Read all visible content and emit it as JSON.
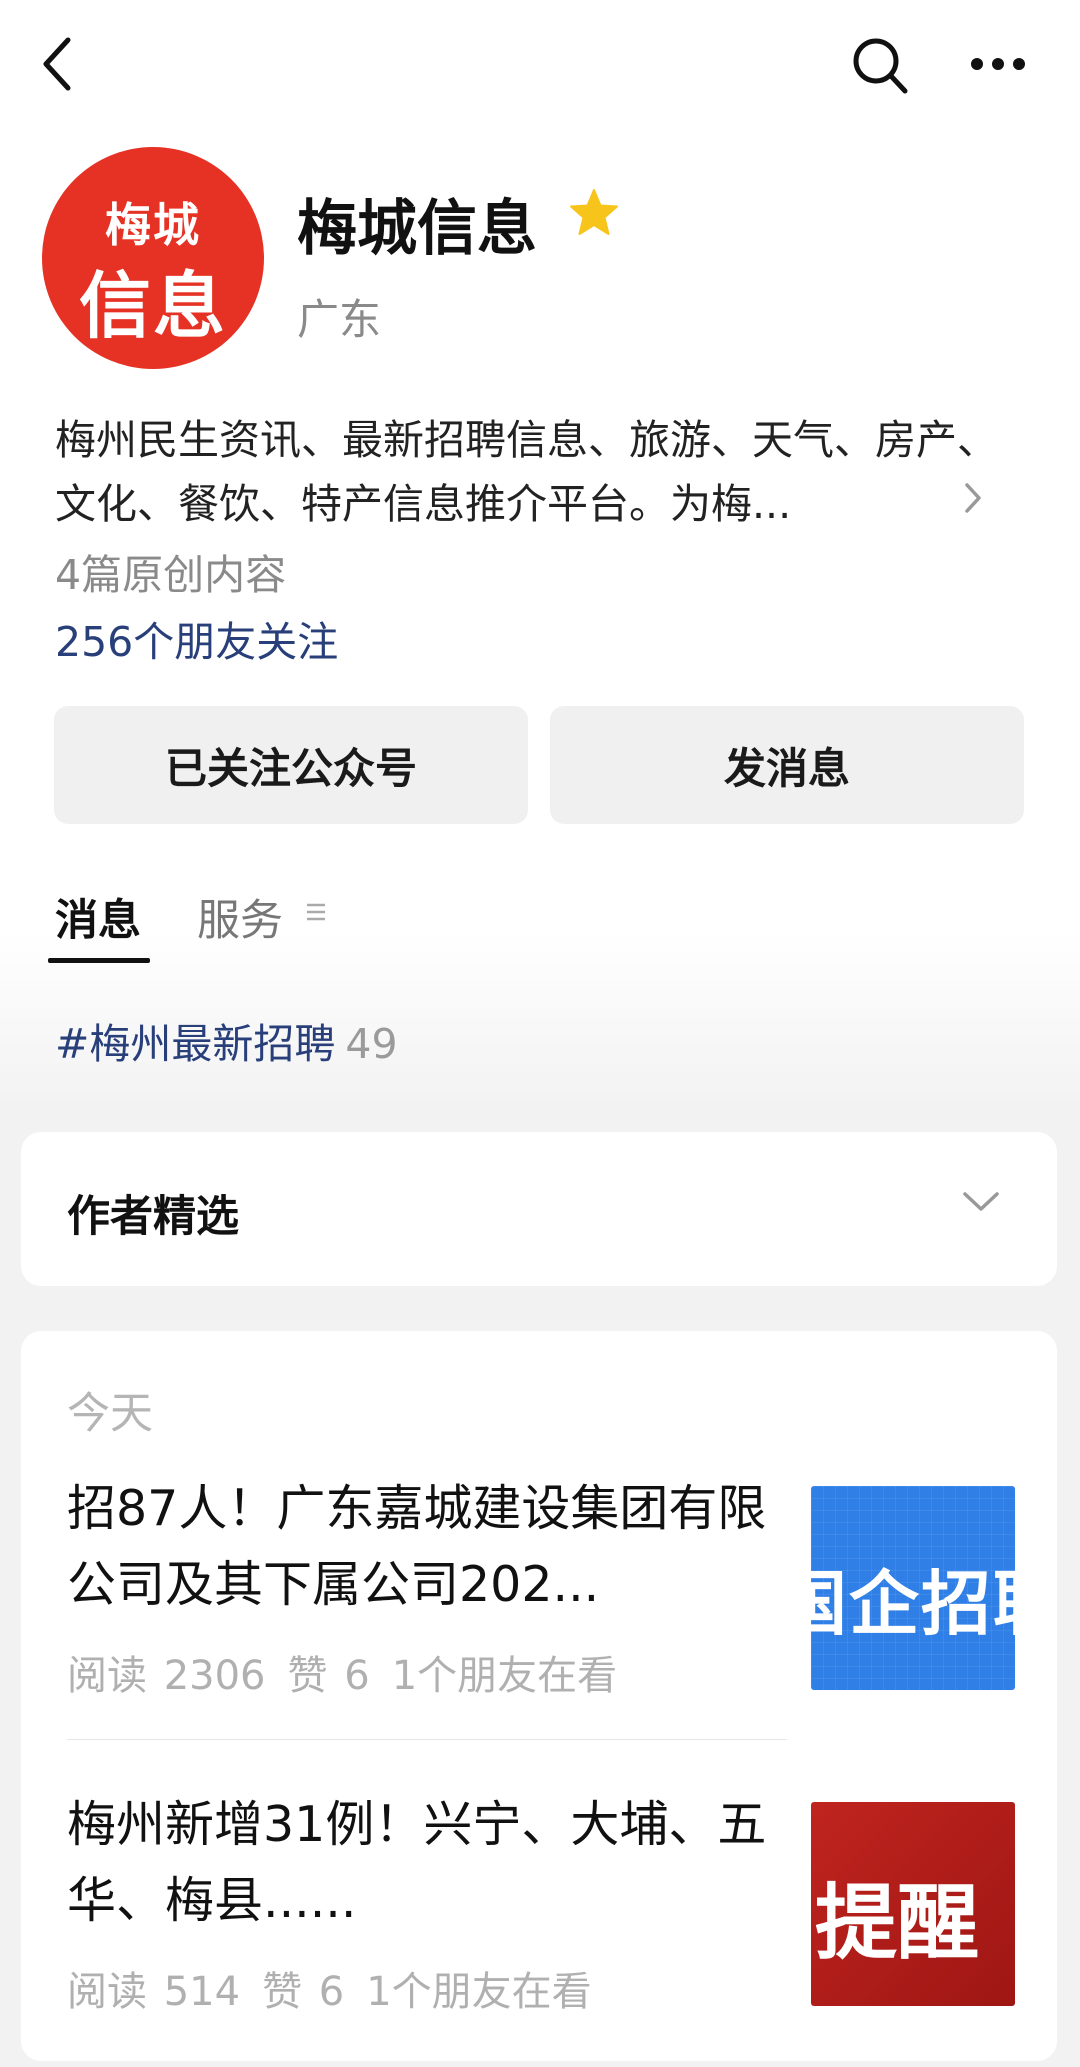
{
  "nav": {
    "back_icon": "back-arrow-icon",
    "search_icon": "search-icon",
    "more_icon": "more-dots-icon"
  },
  "profile": {
    "avatar_line1": "梅城",
    "avatar_line2": "信息",
    "name": "梅城信息",
    "badge_icon": "star-icon",
    "region": "广东",
    "description": "梅州民生资讯、最新招聘信息、旅游、天气、房产、文化、餐饮、特产信息推介平台。为梅...",
    "original_count": "4篇原创内容",
    "friends_following": "256个朋友关注"
  },
  "actions": {
    "follow_label": "已关注公众号",
    "message_label": "发消息"
  },
  "tabs": [
    {
      "label": "消息",
      "active": true
    },
    {
      "label": "服务",
      "active": false
    }
  ],
  "hashtag": {
    "label": "#梅州最新招聘",
    "count": "49"
  },
  "picks": {
    "title": "作者精选"
  },
  "articles_section": {
    "date_label": "今天",
    "items": [
      {
        "title": "招87人！广东嘉城建设集团有限公司及其下属公司202...",
        "reads": "阅读 2306",
        "likes": "赞 6",
        "friends_viewing": "1个朋友在看",
        "thumb_text": "国企招聘"
      },
      {
        "title": "梅州新增31例！兴宁、大埔、五华、梅县......",
        "reads": "阅读 514",
        "likes": "赞 6",
        "friends_viewing": "1个朋友在看",
        "thumb_text": "提醒"
      }
    ]
  },
  "colors": {
    "avatar_red": "#e53225",
    "link_blue": "#283f7a",
    "star_gold": "#f7c41b",
    "thumb_blue": "#2f7fe6",
    "thumb_red": "#c0241f"
  }
}
